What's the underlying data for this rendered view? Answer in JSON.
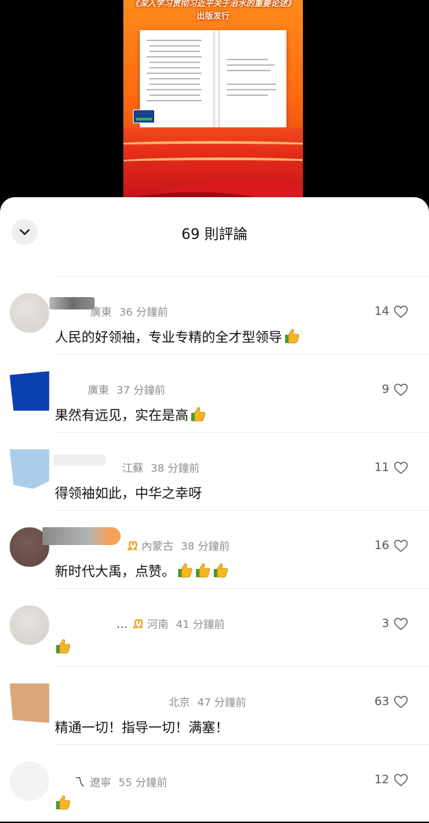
{
  "video": {
    "title_line1": "《深入学习贯彻习近平关于治水的重要论述》",
    "title_line2": "出版发行",
    "logo": "cctv-news-logo"
  },
  "sheet": {
    "comment_count": "69 則評論",
    "collapse_icon": "chevron-down-icon"
  },
  "comments": [
    {
      "name_tail": "",
      "location": "廣東",
      "time": "36 分鐘前",
      "text": "人民的好领袖，专业专精的全才型领导",
      "thumbs": 1,
      "likes": "14"
    },
    {
      "name_tail": "",
      "location": "廣東",
      "time": "37 分鐘前",
      "text": "果然有远见，实在是高",
      "thumbs": 1,
      "likes": "9"
    },
    {
      "name_tail": "",
      "location": "江蘇",
      "time": "38 分鐘前",
      "text": "得领袖如此，中华之幸呀",
      "thumbs": 0,
      "likes": "11"
    },
    {
      "name_tail": "",
      "badge": "ᘻ",
      "location": "內蒙古",
      "time": "38 分鐘前",
      "text": "新时代大禹，点赞。",
      "thumbs": 3,
      "likes": "16"
    },
    {
      "name_tail": "...",
      "badge": "ᘻ",
      "location": "河南",
      "time": "41 分鐘前",
      "text": "",
      "thumbs": 1,
      "likes": "3"
    },
    {
      "name_tail": "",
      "location": "北京",
      "time": "47 分鐘前",
      "text": "精通一切！指导一切！满塞！",
      "thumbs": 0,
      "likes": "63"
    },
    {
      "name_tail": "乁",
      "location": "遼寧",
      "time": "55 分鐘前",
      "text": "",
      "thumbs": 1,
      "likes": "12"
    }
  ],
  "colors": {
    "badge": "#f0a020",
    "meta_text": "#8e8e8e",
    "body_text": "#111111"
  }
}
